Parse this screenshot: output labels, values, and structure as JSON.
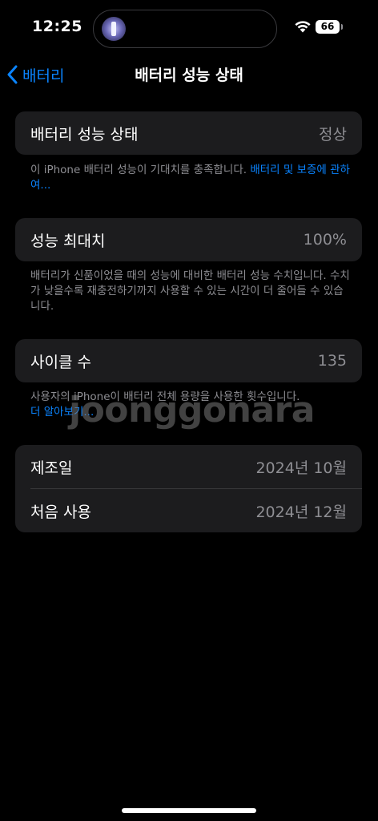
{
  "status_bar": {
    "time": "12:25",
    "battery_level": "66",
    "icons": [
      "flashlight-icon",
      "wifi-icon",
      "battery-icon"
    ]
  },
  "nav": {
    "back_label": "배터리",
    "title": "배터리 성능 상태"
  },
  "sections": {
    "health": {
      "label": "배터리 성능 상태",
      "value": "정상",
      "footnote_text": "이 iPhone 배터리 성능이 기대치를 충족합니다. ",
      "footnote_link": "배터리 및 보증에 관하여..."
    },
    "max_capacity": {
      "label": "성능 최대치",
      "value": "100%",
      "footnote_text": "배터리가 신품이었을 때의 성능에 대비한 배터리 성능 수치입니다. 수치가 낮을수록 재충전하기까지 사용할 수 있는 시간이 더 줄어들 수 있습니다."
    },
    "cycle_count": {
      "label": "사이클 수",
      "value": "135",
      "footnote_text": "사용자의 iPhone이 배터리 전체 용량을 사용한 횟수입니다.",
      "footnote_link": "더 알아보기..."
    },
    "dates": {
      "manufactured_label": "제조일",
      "manufactured_value": "2024년 10월",
      "first_use_label": "처음 사용",
      "first_use_value": "2024년 12월"
    }
  },
  "watermark": "joonggonara",
  "colors": {
    "background": "#000000",
    "card": "#1c1c1e",
    "accent": "#0a84ff",
    "secondary_text": "#8e8e93"
  }
}
